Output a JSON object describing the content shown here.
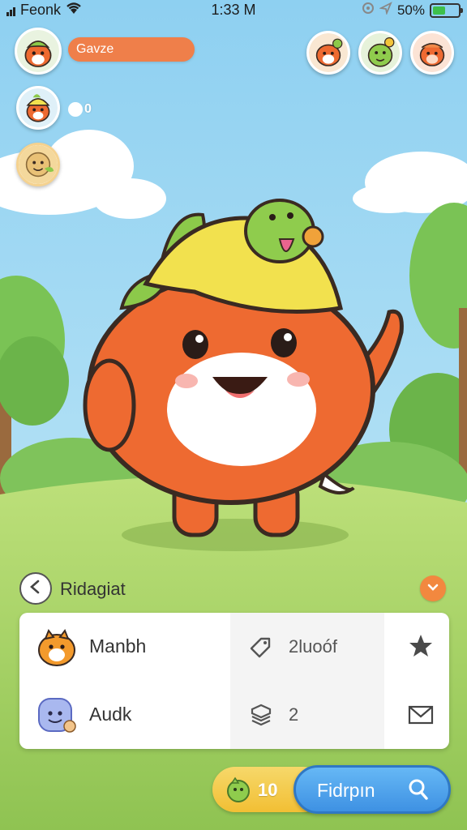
{
  "status_bar": {
    "carrier": "Feonk",
    "time": "1:33 M",
    "battery": "50%",
    "battery_level": 0.5
  },
  "header": {
    "player_name": "Gavze",
    "chat_count": "0"
  },
  "section": {
    "title": "Ridagiat"
  },
  "pets": [
    {
      "name": "Manbh",
      "stat": "2luoóf",
      "stat_icon": "tag-icon",
      "action_icon": "star-icon"
    },
    {
      "name": "Audk",
      "stat": "2",
      "stat_icon": "shield-stack-icon",
      "action_icon": "envelope-icon"
    }
  ],
  "footer": {
    "coins": "10",
    "find_label": "Fidrpın"
  },
  "colors": {
    "accent_orange": "#ef7f4a",
    "button_blue": "#4a9de8",
    "coin_yellow": "#f4c94a",
    "sky": "#9bd6f2",
    "grass": "#a9d46b"
  }
}
